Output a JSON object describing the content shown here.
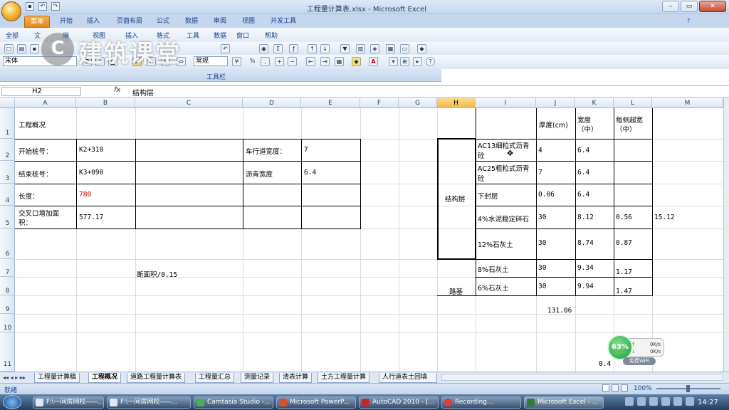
{
  "window": {
    "title": "工程量计算表.xlsx - Microsoft Excel"
  },
  "ribbon_tabs": [
    "菜单",
    "开始",
    "插入",
    "页面布局",
    "公式",
    "数据",
    "审阅",
    "视图",
    "开发工具"
  ],
  "menu_items": [
    "全部",
    "文",
    "编",
    "视图",
    "插入",
    "格式",
    "工具",
    "数据",
    "窗口",
    "帮助"
  ],
  "toolbar": {
    "font_name": "宋体",
    "style_value": "常规",
    "percent_label": "%",
    "footer_label": "工具栏"
  },
  "watermark": {
    "text": "建筑课堂"
  },
  "formula_bar": {
    "name_box": "H2",
    "fx": "fx",
    "formula": "结构层"
  },
  "columns": [
    "A",
    "B",
    "C",
    "D",
    "E",
    "F",
    "G",
    "H",
    "I",
    "J",
    "K",
    "L",
    "M"
  ],
  "rows": [
    "1",
    "2",
    "3",
    "4",
    "5",
    "6",
    "7",
    "8",
    "9",
    "10",
    "11"
  ],
  "cells": {
    "A1": "工程概况",
    "A2": "开始桩号：",
    "B2": "K2+310",
    "D2": "车行道宽度：",
    "E2": "7",
    "A3": "结束桩号：",
    "B3": "K3+090",
    "D3": "沥青宽度",
    "E3": "6.4",
    "A4": "长度：",
    "B4": "780",
    "A5_l1": "交叉口增加面",
    "A5_l2": "积：",
    "B5": "577.17",
    "C7": "断面积/0.15",
    "J1": "厚度(cm)",
    "K1_l1": "宽度",
    "K1_l2": "（中）",
    "L1_l1": "每侧超宽",
    "L1_l2": "（中）",
    "H_struct": "结构层",
    "H_road": "路基",
    "I2_l1": "AC13细粒式沥青",
    "I2_l2": "砼",
    "J2": "4",
    "K2": "6.4",
    "I3_l1": "AC25粗粒式沥青",
    "I3_l2": "砼",
    "J3": "7",
    "K3": "6.4",
    "I4": "下封层",
    "J4": "0.06",
    "K4": "6.4",
    "I5": "4%水泥稳定碎石",
    "J5": "30",
    "K5": "8.12",
    "L5": "0.56",
    "M5": "15.12",
    "I6": "12%石灰土",
    "J6": "30",
    "K6": "8.74",
    "L6": "0.87",
    "I7": "8%石灰土",
    "J7": "30",
    "K7": "9.34",
    "L7": "1.17",
    "I8": "6%石灰土",
    "J8": "30",
    "K8": "9.94",
    "L8": "1.47",
    "J9": "131.06",
    "L11": "0.4"
  },
  "colors": {
    "red_value": "#c00000",
    "selected_header": "#f2b447"
  },
  "sheet_tabs": [
    "工程量计算稿",
    "工程概况",
    "道路工程量计算表",
    "工程量汇总",
    "测量记录",
    "清表计算",
    "土方工程量计算",
    "人行道表土回填"
  ],
  "status": {
    "ready": "就绪",
    "zoom": "100%"
  },
  "net_widget": {
    "percent": "63%",
    "up": "0K/s",
    "down": "0K/s",
    "wifi": "免费WiFi"
  },
  "taskbar": {
    "items": [
      "F:\\一间房网校-----...",
      "F:\\一间房网校-----...",
      "Camtasia Studio -...",
      "Microsoft PowerP...",
      "AutoCAD 2010 - [...",
      "Recording...",
      "Microsoft Excel - ..."
    ],
    "clock": "14:27"
  }
}
